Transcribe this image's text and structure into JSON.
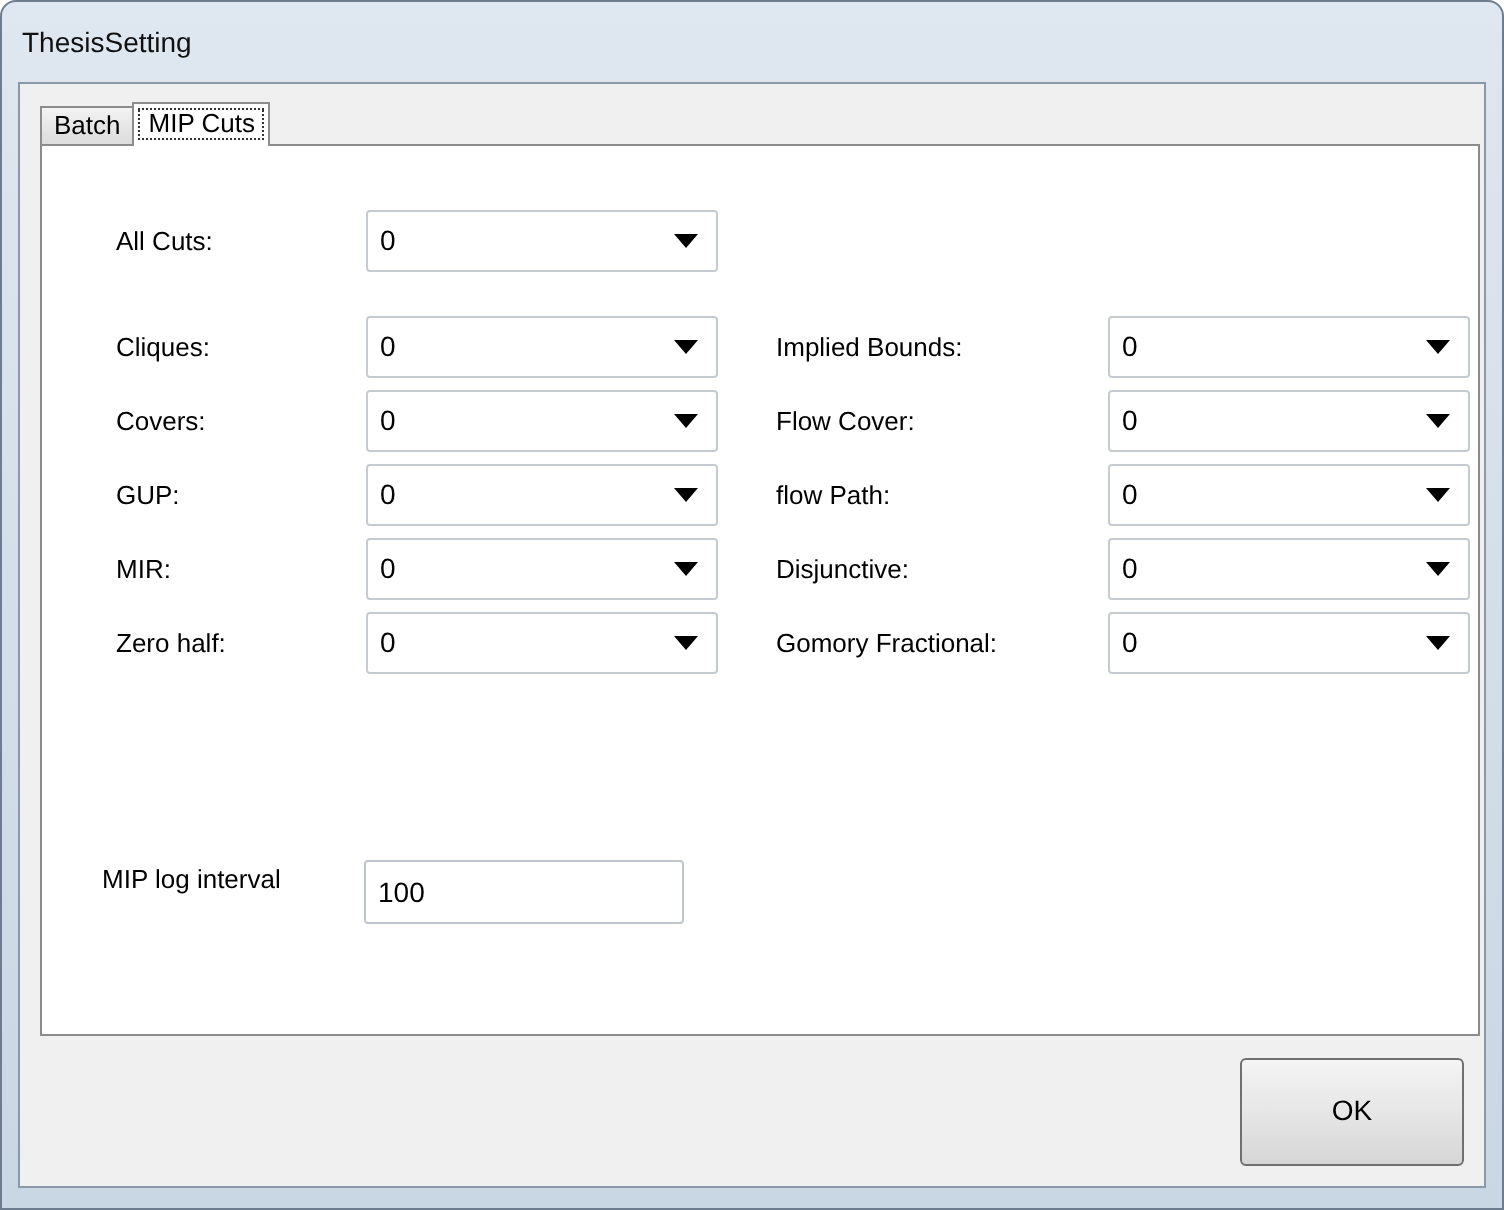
{
  "window": {
    "title": "ThesisSetting"
  },
  "tabs": [
    {
      "label": "Batch",
      "selected": false
    },
    {
      "label": "MIP Cuts",
      "selected": true
    }
  ],
  "all_cuts": {
    "label": "All Cuts:",
    "value": "0"
  },
  "left_cuts": [
    {
      "label": "Cliques:",
      "value": "0"
    },
    {
      "label": "Covers:",
      "value": "0"
    },
    {
      "label": "GUP:",
      "value": "0"
    },
    {
      "label": "MIR:",
      "value": "0"
    },
    {
      "label": "Zero half:",
      "value": "0"
    }
  ],
  "right_cuts": [
    {
      "label": "Implied Bounds:",
      "value": "0"
    },
    {
      "label": "Flow Cover:",
      "value": "0"
    },
    {
      "label": "flow Path:",
      "value": "0"
    },
    {
      "label": "Disjunctive:",
      "value": "0"
    },
    {
      "label": "Gomory Fractional:",
      "value": "0"
    }
  ],
  "log_interval": {
    "label": "MIP log interval",
    "value": "100"
  },
  "buttons": [
    "OK"
  ]
}
